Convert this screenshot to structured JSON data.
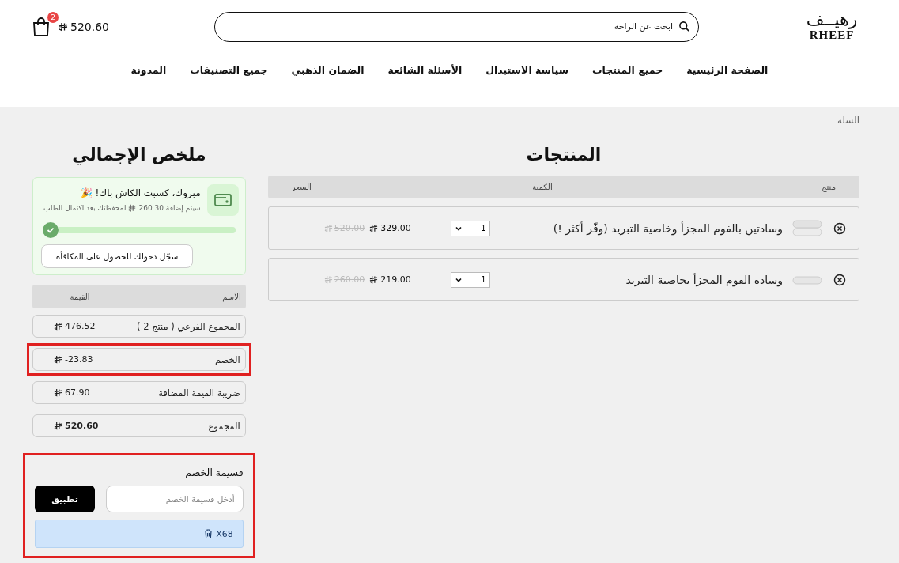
{
  "header": {
    "logo": {
      "arabic": "رهيــف",
      "latin": "RHEEF"
    },
    "search": {
      "placeholder": "ابحث عن الراحة"
    },
    "cart": {
      "count": "2",
      "total": "520.60"
    }
  },
  "nav": [
    "الصفحة الرئيسية",
    "جميع المنتجات",
    "سياسة الاستبدال",
    "الأسئلة الشائعة",
    "الضمان الذهبي",
    "جميع التصنيفات",
    "المدونة"
  ],
  "breadcrumb": "السلة",
  "products": {
    "title": "المنتجات",
    "columns": [
      "منتج",
      "الكمية",
      "السعر"
    ],
    "rows": [
      {
        "name": "وسادتين بالفوم المجزأ وخاصية التبريد (وفّر أكثر !)",
        "quantity": "1",
        "price": "329.00",
        "old_price": "520.00"
      },
      {
        "name": "وسادة الفوم المجزأ بخاصية التبريد",
        "quantity": "1",
        "price": "219.00",
        "old_price": "260.00"
      }
    ]
  },
  "summary": {
    "title": "ملخص الإجمالي",
    "cashback": {
      "title": "مبروك، كسبت الكاش باك! 🎉",
      "text_before": "سيتم إضافة 260.30",
      "text_after": "لمحفظتك بعد اكتمال الطلب.",
      "level": 1,
      "button": "سجّل دخولك للحصول على المكافأة"
    },
    "columns": [
      "الاسم",
      "القيمة"
    ],
    "rows": [
      {
        "name": "المجموع الفرعي ( منتج 2 )",
        "value": "476.52",
        "bold": false,
        "highlighted": false
      },
      {
        "name": "الخصم",
        "value": "-23.83",
        "bold": false,
        "highlighted": true
      },
      {
        "name": "ضريبة القيمة المضافة",
        "value": "67.90",
        "bold": false,
        "highlighted": false
      },
      {
        "name": "المجموع",
        "value": "520.60",
        "bold": true,
        "highlighted": false
      }
    ],
    "coupon": {
      "title": "قسيمة الخصم",
      "placeholder": "أدخل قسيمة الخصم",
      "button": "تطبيق",
      "applied": "X68",
      "highlighted": true
    }
  }
}
